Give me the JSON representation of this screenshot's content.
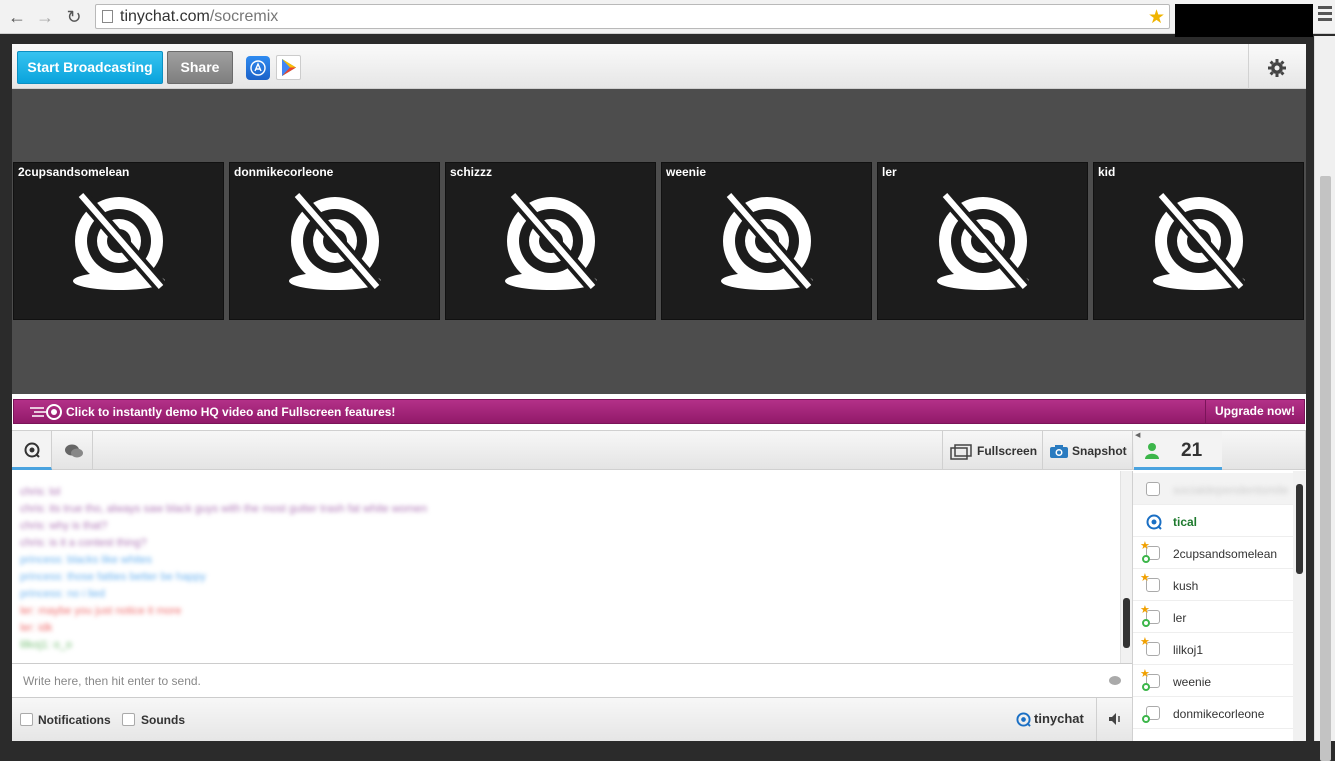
{
  "browser": {
    "url_host": "tinychat.com",
    "url_path": "/socremix"
  },
  "toolbar": {
    "broadcast_label": "Start Broadcasting",
    "share_label": "Share"
  },
  "videos": [
    {
      "name": "2cupsandsomelean"
    },
    {
      "name": "donmikecorleone"
    },
    {
      "name": "schizzz"
    },
    {
      "name": "weenie"
    },
    {
      "name": "ler"
    },
    {
      "name": "kid"
    }
  ],
  "promo": {
    "text": "Click to instantly demo HQ video and Fullscreen features!",
    "upgrade_label": "Upgrade now!"
  },
  "chat": {
    "fullscreen_label": "Fullscreen",
    "snapshot_label": "Snapshot",
    "input_placeholder": "Write here, then hit enter to send.",
    "notifications_label": "Notifications",
    "sounds_label": "Sounds",
    "logo_text": "tinychat",
    "messages": [
      {
        "text": "chris: lol",
        "color": "#b07ab8"
      },
      {
        "text": "chris: its true tho, always saw black guys with the most gutter trash fat white women",
        "color": "#b07ab8"
      },
      {
        "text": "chris: why is that?",
        "color": "#b07ab8"
      },
      {
        "text": "chris: is it a contest thing?",
        "color": "#b07ab8"
      },
      {
        "text": "princess: blacks like whites",
        "color": "#6cb3f0"
      },
      {
        "text": "princess: those fatties better be happy",
        "color": "#6cb3f0"
      },
      {
        "text": "princess: no i lied",
        "color": "#6cb3f0"
      },
      {
        "text": "ler: maybe you just notice it more",
        "color": "#f07070"
      },
      {
        "text": "ler: idk",
        "color": "#f07070"
      },
      {
        "text": "lilkoj1: o_o",
        "color": "#7cc27c"
      }
    ]
  },
  "users": {
    "count": "21",
    "items": [
      {
        "name": "socialdependentsmile",
        "me": true,
        "star": false,
        "cam": false
      },
      {
        "name": "tical",
        "op": true,
        "star": false,
        "cam": false
      },
      {
        "name": "2cupsandsomelean",
        "star": true,
        "cam": true
      },
      {
        "name": "kush",
        "star": true,
        "cam": false
      },
      {
        "name": "ler",
        "star": true,
        "cam": true
      },
      {
        "name": "lilkoj1",
        "star": true,
        "cam": false
      },
      {
        "name": "weenie",
        "star": true,
        "cam": true
      },
      {
        "name": "donmikecorleone",
        "star": false,
        "cam": true
      }
    ]
  }
}
